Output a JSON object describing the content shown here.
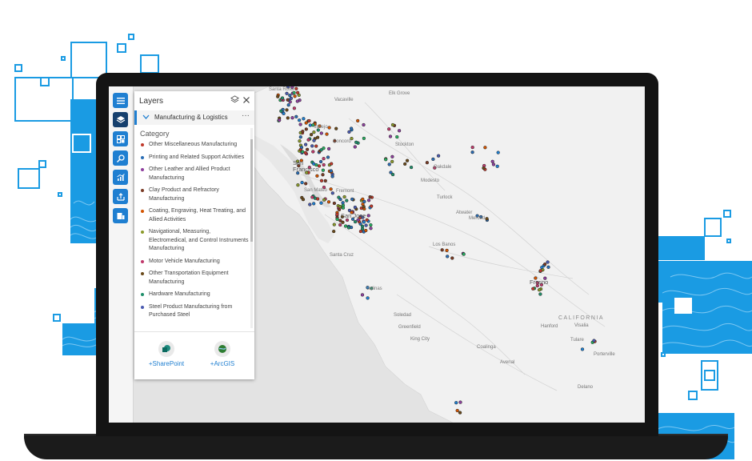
{
  "toolbar": {
    "buttons": [
      {
        "icon": "menu-icon"
      },
      {
        "icon": "layers-icon",
        "active": true
      },
      {
        "icon": "basemap-gallery-icon"
      },
      {
        "icon": "search-icon"
      },
      {
        "icon": "analysis-icon"
      },
      {
        "icon": "share-icon"
      },
      {
        "icon": "data-icon"
      }
    ]
  },
  "layers_panel": {
    "title": "Layers",
    "layer_name": "Manufacturing & Logistics",
    "more_label": "···",
    "category_label": "Category",
    "categories": [
      {
        "label": "Other Miscellaneous Manufacturing",
        "color": "#c0392b"
      },
      {
        "label": "Printing and Related Support Activities",
        "color": "#2a6db5"
      },
      {
        "label": "Other Leather and Allied Product Manufacturing",
        "color": "#8e3f9e"
      },
      {
        "label": "Clay Product and Refractory Manufacturing",
        "color": "#7a3b25"
      },
      {
        "label": "Coating, Engraving, Heat Treating, and Allied Activities",
        "color": "#d35400"
      },
      {
        "label": "Navigational, Measuring, Electromedical, and Control Instruments Manufacturing",
        "color": "#8a9a2a"
      },
      {
        "label": "Motor Vehicle Manufacturing",
        "color": "#c0396b"
      },
      {
        "label": "Other Transportation Equipment Manufacturing",
        "color": "#6b4a1a"
      },
      {
        "label": "Hardware Manufacturing",
        "color": "#1f8f6a"
      },
      {
        "label": "Steel Product Manufacturing from Purchased Steel",
        "color": "#4a5ab0"
      }
    ],
    "connectors": [
      {
        "label": "+SharePoint",
        "icon": "sharepoint-icon"
      },
      {
        "label": "+ArcGIS",
        "icon": "arcgis-icon"
      }
    ]
  },
  "map": {
    "places": [
      {
        "name": "Santa Rosa"
      },
      {
        "name": "Vacaville"
      },
      {
        "name": "Elk Grove"
      },
      {
        "name": "Vallejo"
      },
      {
        "name": "Concord"
      },
      {
        "name": "Stockton"
      },
      {
        "name": "San Francisco"
      },
      {
        "name": "Oakdale"
      },
      {
        "name": "Modesto"
      },
      {
        "name": "San Mateo"
      },
      {
        "name": "Fremont"
      },
      {
        "name": "Turlock"
      },
      {
        "name": "San Jose"
      },
      {
        "name": "Atwater"
      },
      {
        "name": "Merced"
      },
      {
        "name": "Los Banos"
      },
      {
        "name": "Santa Cruz"
      },
      {
        "name": "Fresno"
      },
      {
        "name": "Salinas"
      },
      {
        "name": "CALIFORNIA"
      },
      {
        "name": "Soledad"
      },
      {
        "name": "Hanford"
      },
      {
        "name": "Visalia"
      },
      {
        "name": "Greenfield"
      },
      {
        "name": "King City"
      },
      {
        "name": "Tulare"
      },
      {
        "name": "Porterville"
      },
      {
        "name": "Coalinga"
      },
      {
        "name": "Avenal"
      },
      {
        "name": "Delano"
      }
    ]
  },
  "colors": {
    "accent": "#1f7fd1",
    "deco_blue": "#1a9be3",
    "ocean": "#e3e3e3",
    "land": "#f1f1f1"
  }
}
